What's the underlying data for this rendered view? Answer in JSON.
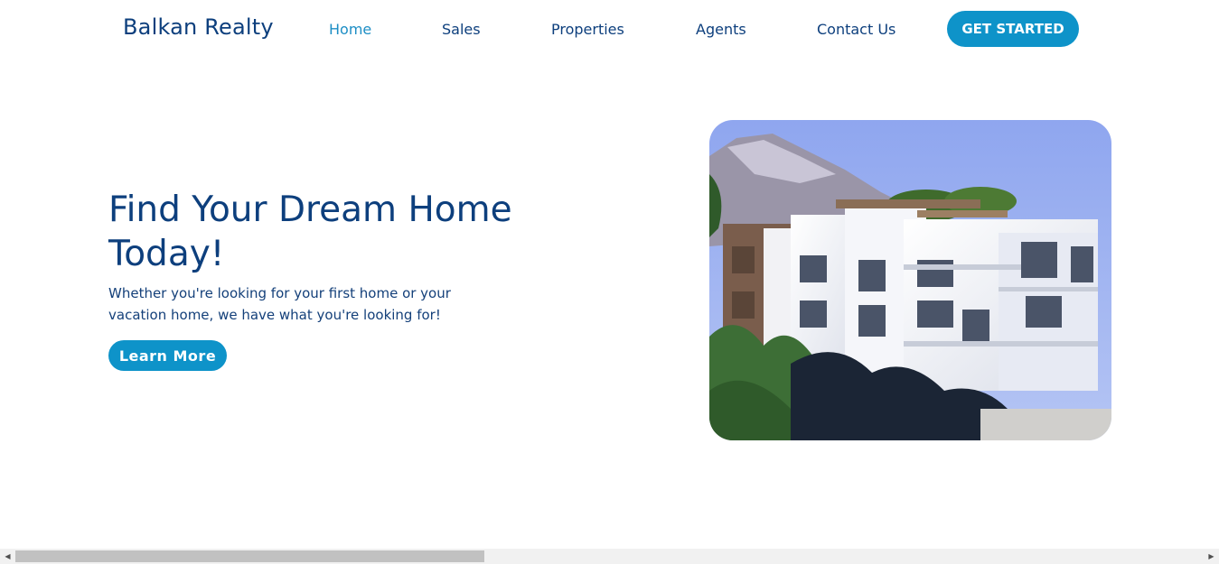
{
  "navbar": {
    "brand": "Balkan Realty",
    "links": [
      {
        "label": "Home",
        "active": true
      },
      {
        "label": "Sales"
      },
      {
        "label": "Properties"
      },
      {
        "label": "Agents"
      },
      {
        "label": "Contact Us"
      }
    ],
    "cta_label": "GET STARTED"
  },
  "hero": {
    "title": "Find Your Dream Home Today!",
    "subtitle": "Whether you're looking for your first home or your vacation home, we have what you're looking for!",
    "button_label": "Learn More",
    "image_icon": "building-photo"
  },
  "scrollbar": {
    "left_icon": "arrow-left-icon",
    "right_icon": "arrow-right-icon"
  },
  "colors": {
    "brand_navy": "#0d3f7d",
    "accent_blue": "#0e93c9",
    "active_link": "#1d8ec5"
  }
}
